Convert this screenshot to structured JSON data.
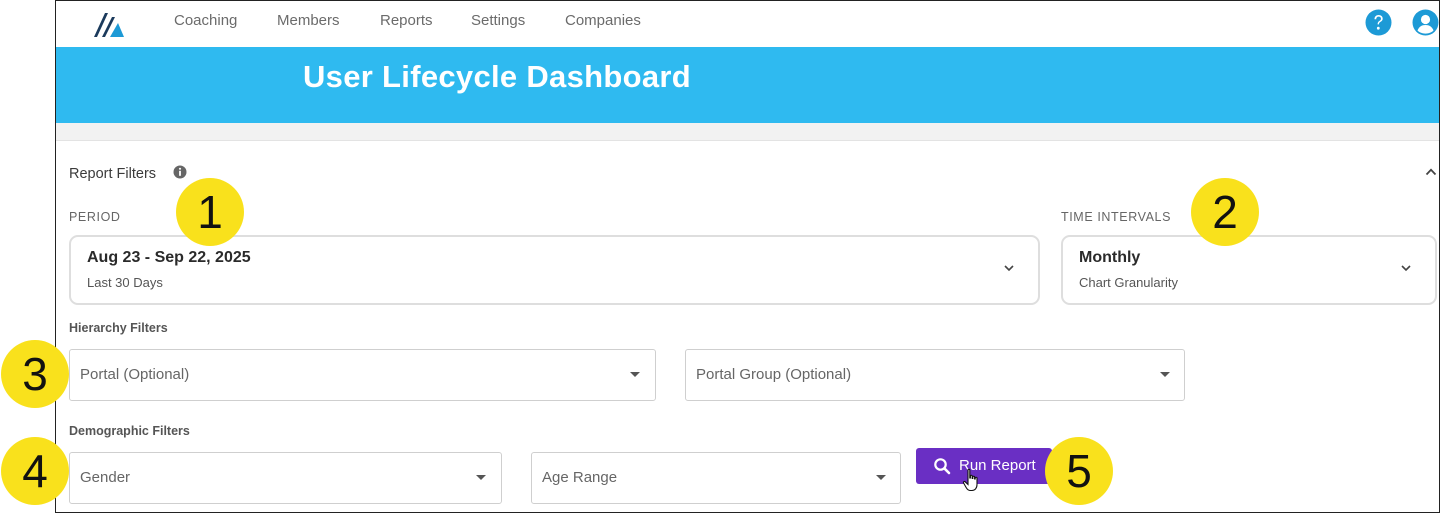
{
  "nav": {
    "items": [
      "Coaching",
      "Members",
      "Reports",
      "Settings",
      "Companies"
    ]
  },
  "banner": {
    "title": "User Lifecycle Dashboard"
  },
  "filters": {
    "title": "Report Filters",
    "period": {
      "label": "PERIOD",
      "value": "Aug 23 - Sep 22, 2025",
      "sub": "Last 30 Days"
    },
    "interval": {
      "label": "TIME INTERVALS",
      "value": "Monthly",
      "sub": "Chart Granularity"
    },
    "hierarchy": {
      "label": "Hierarchy Filters",
      "portal_placeholder": "Portal (Optional)",
      "portal_group_placeholder": "Portal Group (Optional)"
    },
    "demographic": {
      "label": "Demographic Filters",
      "gender_placeholder": "Gender",
      "age_placeholder": "Age Range"
    },
    "run_label": "Run Report"
  },
  "callouts": [
    "1",
    "2",
    "3",
    "4",
    "5"
  ],
  "colors": {
    "banner": "#2fbaf0",
    "run_button": "#6a2fc4",
    "callout": "#f9e11c",
    "icon_blue": "#1d9ad6"
  },
  "icons": {
    "logo": "logo-icon",
    "help": "question-circle-icon",
    "user": "user-circle-icon",
    "info": "info-icon",
    "collapse": "chevron-up-icon",
    "dropdown": "chevron-down-icon",
    "search": "search-icon",
    "cursor": "hand-pointer-icon"
  }
}
